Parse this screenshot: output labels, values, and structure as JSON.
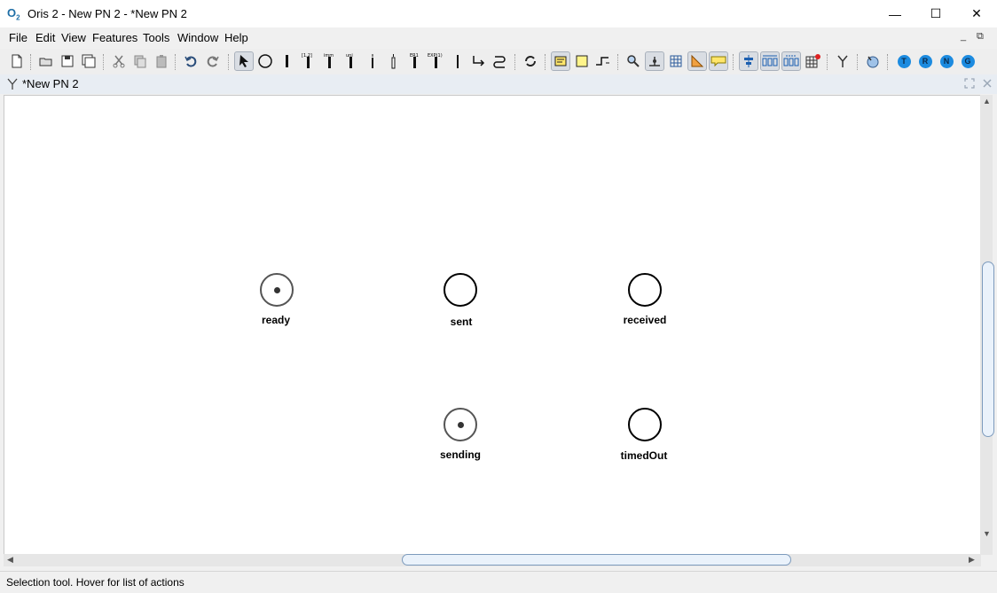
{
  "window": {
    "logo_text": "O",
    "logo_sub": "2",
    "title": "Oris 2 - New PN 2 - *New PN 2",
    "minimize": "—",
    "maximize": "☐",
    "close": "✕"
  },
  "menu": [
    "File",
    "Edit",
    "View",
    "Features",
    "Tools",
    "Window",
    "Help"
  ],
  "mdi": {
    "minimize": "_",
    "restore": "⧉"
  },
  "toolbar": {
    "badges": {
      "t": "T",
      "r": "R",
      "n": "N",
      "g": "G"
    },
    "labels": {
      "imm": "imm",
      "exp": "EXP(1)",
      "uni": "uni",
      "det": "[1,2]",
      "erl": "ER1"
    }
  },
  "document_tab": {
    "title": "*New PN 2"
  },
  "petri_net": {
    "places": [
      {
        "name": "ready",
        "tokens": 1
      },
      {
        "name": "sent",
        "tokens": 0
      },
      {
        "name": "received",
        "tokens": 0
      },
      {
        "name": "sending",
        "tokens": 1
      },
      {
        "name": "timedOut",
        "tokens": 0
      }
    ]
  },
  "status": {
    "text": "Selection tool. Hover for list of actions"
  }
}
